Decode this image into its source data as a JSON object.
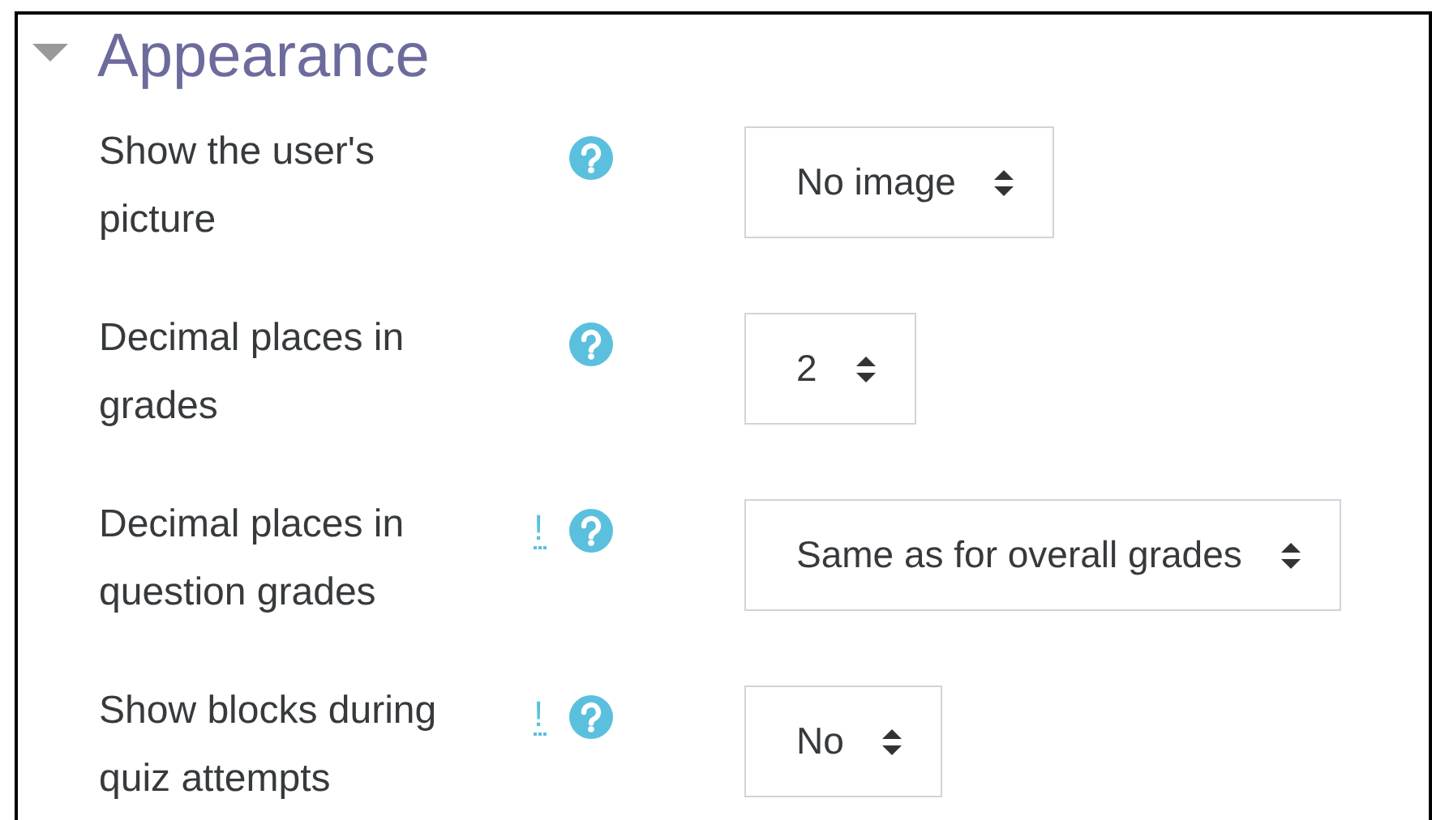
{
  "section": {
    "title": "Appearance",
    "expanded": true
  },
  "settings": [
    {
      "label": "Show the user's picture",
      "help": true,
      "value": "No image"
    },
    {
      "label": "Decimal places in grades",
      "help": true,
      "value": "2"
    },
    {
      "label": "Decimal places in question grades",
      "advanced_marker": "!",
      "help": true,
      "value": "Same as for overall grades"
    },
    {
      "label": "Show blocks during quiz attempts",
      "advanced_marker": "!",
      "help": true,
      "value": "No"
    }
  ]
}
